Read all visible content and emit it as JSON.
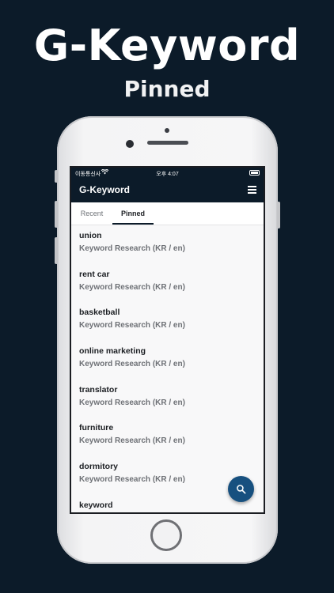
{
  "promo": {
    "title": "G-Keyword",
    "subtitle": "Pinned"
  },
  "statusbar": {
    "carrier": "이동통신사",
    "time": "오후 4:07"
  },
  "appbar": {
    "title": "G-Keyword",
    "menu_icon": "hamburger-menu-icon"
  },
  "tabs": [
    {
      "label": "Recent",
      "active": false
    },
    {
      "label": "Pinned",
      "active": true
    }
  ],
  "items": [
    {
      "title": "union",
      "subtitle": "Keyword Research (KR / en)"
    },
    {
      "title": "rent car",
      "subtitle": "Keyword Research (KR / en)"
    },
    {
      "title": "basketball",
      "subtitle": "Keyword Research (KR / en)"
    },
    {
      "title": "online marketing",
      "subtitle": "Keyword Research (KR / en)"
    },
    {
      "title": "translator",
      "subtitle": "Keyword Research (KR / en)"
    },
    {
      "title": "furniture",
      "subtitle": "Keyword Research (KR / en)"
    },
    {
      "title": "dormitory",
      "subtitle": "Keyword Research (KR / en)"
    },
    {
      "title": "keyword",
      "subtitle": ""
    }
  ],
  "fab": {
    "icon": "search-icon"
  },
  "colors": {
    "background": "#0c1b29",
    "fab": "#17507f",
    "tab_indicator": "#0c1b29"
  }
}
